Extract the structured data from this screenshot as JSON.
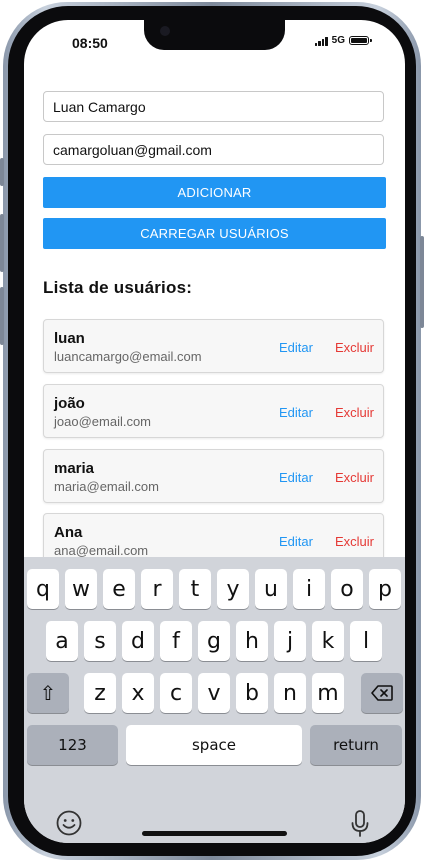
{
  "status_bar": {
    "time": "08:50",
    "network": "5G"
  },
  "form": {
    "name_value": "Luan Camargo",
    "email_value": "camargoluan@gmail.com",
    "add_button": "ADICIONAR",
    "load_button": "CARREGAR USUÁRIOS"
  },
  "list": {
    "title": "Lista de usuários:",
    "edit_label": "Editar",
    "delete_label": "Excluir",
    "users": [
      {
        "name": "luan",
        "email": "luancamargo@email.com"
      },
      {
        "name": "joão",
        "email": "joao@email.com"
      },
      {
        "name": "maria",
        "email": "maria@email.com"
      },
      {
        "name": "Ana",
        "email": "ana@email.com"
      }
    ]
  },
  "keyboard": {
    "row1": [
      "q",
      "w",
      "e",
      "r",
      "t",
      "y",
      "u",
      "i",
      "o",
      "p"
    ],
    "row2": [
      "a",
      "s",
      "d",
      "f",
      "g",
      "h",
      "j",
      "k",
      "l"
    ],
    "row3": [
      "z",
      "x",
      "c",
      "v",
      "b",
      "n",
      "m"
    ],
    "shift": "⇧",
    "numbers_label": "123",
    "space_label": "space",
    "return_label": "return",
    "icons": [
      "shift-icon",
      "backspace-icon",
      "emoji-icon",
      "microphone-icon"
    ]
  },
  "colors": {
    "accent": "#2196f3",
    "danger": "#e53935",
    "keyboard_bg": "#d1d4da"
  }
}
